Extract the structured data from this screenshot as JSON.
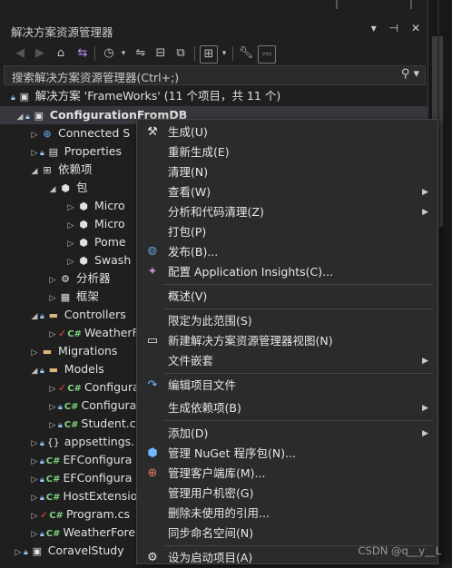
{
  "panel": {
    "title": "解决方案资源管理器",
    "title_buttons": [
      "▾",
      "⊣",
      "✕"
    ]
  },
  "search": {
    "placeholder": "搜索解决方案资源管理器(Ctrl+;)"
  },
  "tree": {
    "solution": "解决方案 'FrameWorks' (11 个项目，共 11 个)",
    "project": "ConfigurationFromDB",
    "items": [
      {
        "label": "Connected S"
      },
      {
        "label": "Properties"
      },
      {
        "label": "依赖项"
      },
      {
        "label": "包"
      },
      {
        "label": "Micro"
      },
      {
        "label": "Micro"
      },
      {
        "label": "Pome"
      },
      {
        "label": "Swash"
      },
      {
        "label": "分析器"
      },
      {
        "label": "框架"
      },
      {
        "label": "Controllers"
      },
      {
        "label": "WeatherF"
      },
      {
        "label": "Migrations"
      },
      {
        "label": "Models"
      },
      {
        "label": "Configura"
      },
      {
        "label": "Configura"
      },
      {
        "label": "Student.c"
      },
      {
        "label": "appsettings."
      },
      {
        "label": "EFConfigura"
      },
      {
        "label": "EFConfigura"
      },
      {
        "label": "HostExtensio"
      },
      {
        "label": "Program.cs"
      },
      {
        "label": "WeatherFore"
      },
      {
        "label": "CoravelStudy"
      }
    ]
  },
  "menu": {
    "items": [
      "生成(U)",
      "重新生成(E)",
      "清理(N)",
      "查看(W)",
      "分析和代码清理(Z)",
      "打包(P)",
      "发布(B)...",
      "配置 Application Insights(C)...",
      "概述(V)",
      "限定为此范围(S)",
      "新建解决方案资源管理器视图(N)",
      "文件嵌套",
      "编辑项目文件",
      "生成依赖项(B)",
      "添加(D)",
      "管理 NuGet 程序包(N)...",
      "管理客户端库(M)...",
      "管理用户机密(G)",
      "删除未使用的引用...",
      "同步命名空间(N)",
      "设为启动项目(A)"
    ]
  },
  "watermark": "CSDN @q__y__L",
  "colors": {
    "background": "#1f1f1f",
    "menu_background": "#2b2b2b",
    "selection": "#37373d",
    "csharp": "#7fd47f",
    "lock": "#9ccfff"
  }
}
